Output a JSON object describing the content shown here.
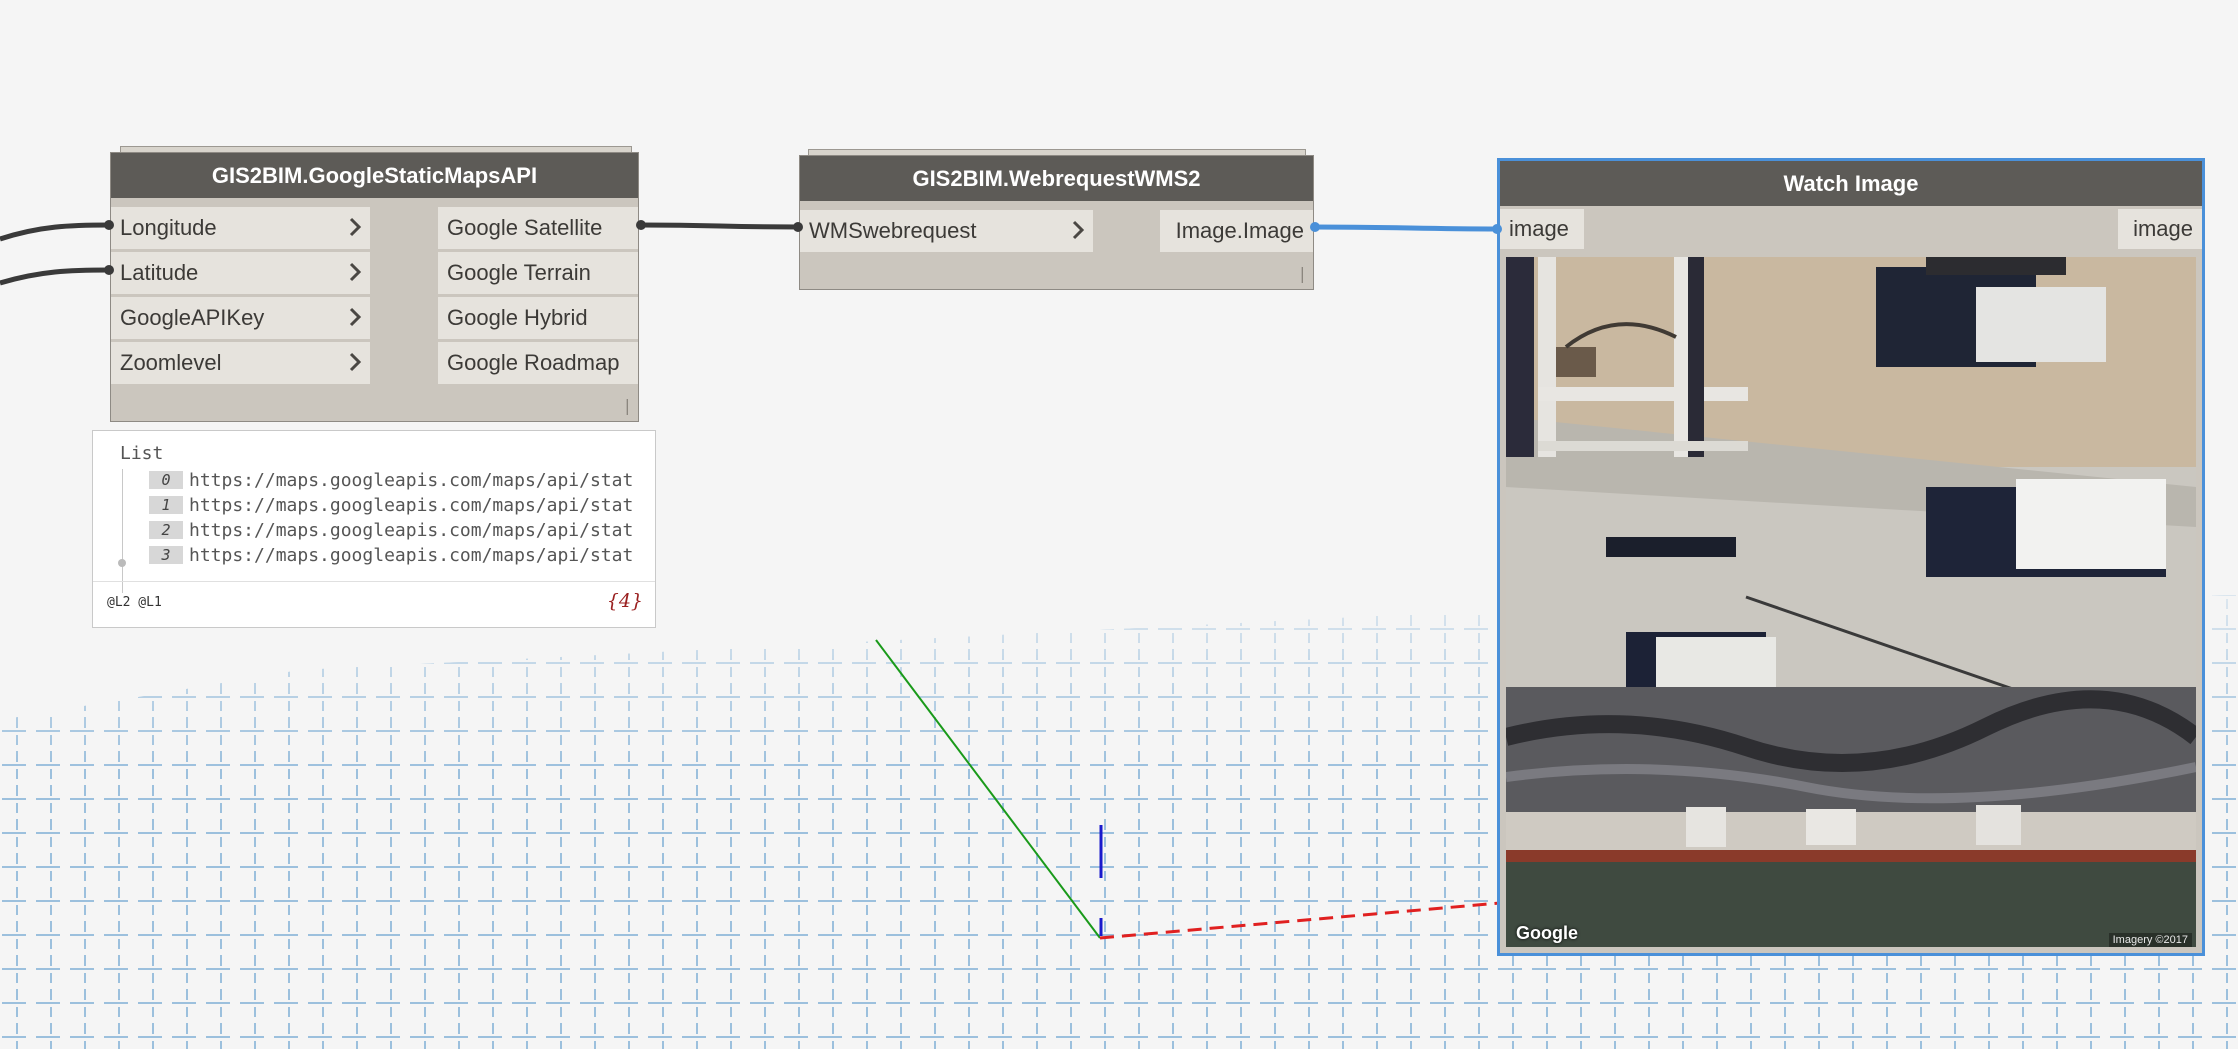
{
  "nodes": {
    "google_static_maps": {
      "title": "GIS2BIM.GoogleStaticMapsAPI",
      "inputs": [
        "Longitude",
        "Latitude",
        "GoogleAPIKey",
        "Zoomlevel"
      ],
      "outputs": [
        "Google Satellite",
        "Google Terrain",
        "Google Hybrid",
        "Google Roadmap"
      ],
      "footer": "|"
    },
    "webrequest_wms2": {
      "title": "GIS2BIM.WebrequestWMS2",
      "input": "WMSwebrequest",
      "output": "Image.Image",
      "footer": "|"
    },
    "watch_image": {
      "title": "Watch Image",
      "input": "image",
      "output": "image",
      "image": {
        "watermark": "Google",
        "credit": "Imagery ©2017"
      }
    }
  },
  "list_preview": {
    "header": "List",
    "items": [
      {
        "index": "0",
        "value": "https://maps.googleapis.com/maps/api/stat"
      },
      {
        "index": "1",
        "value": "https://maps.googleapis.com/maps/api/stat"
      },
      {
        "index": "2",
        "value": "https://maps.googleapis.com/maps/api/stat"
      },
      {
        "index": "3",
        "value": "https://maps.googleapis.com/maps/api/stat"
      }
    ],
    "levels": "@L2 @L1",
    "count": "{4}"
  },
  "colors": {
    "canvas": "#f5f5f5",
    "node_header": "#5d5b57",
    "node_body": "#cbc6be",
    "port": "#e6e3dd",
    "selected_border": "#4a90d9",
    "wire": "#3a3a3a",
    "selected_wire": "#4a90d9",
    "grid": "#9cc0dd",
    "axis_x": "#e02020",
    "axis_y": "#1a9a1a",
    "axis_z": "#1a1acc"
  }
}
